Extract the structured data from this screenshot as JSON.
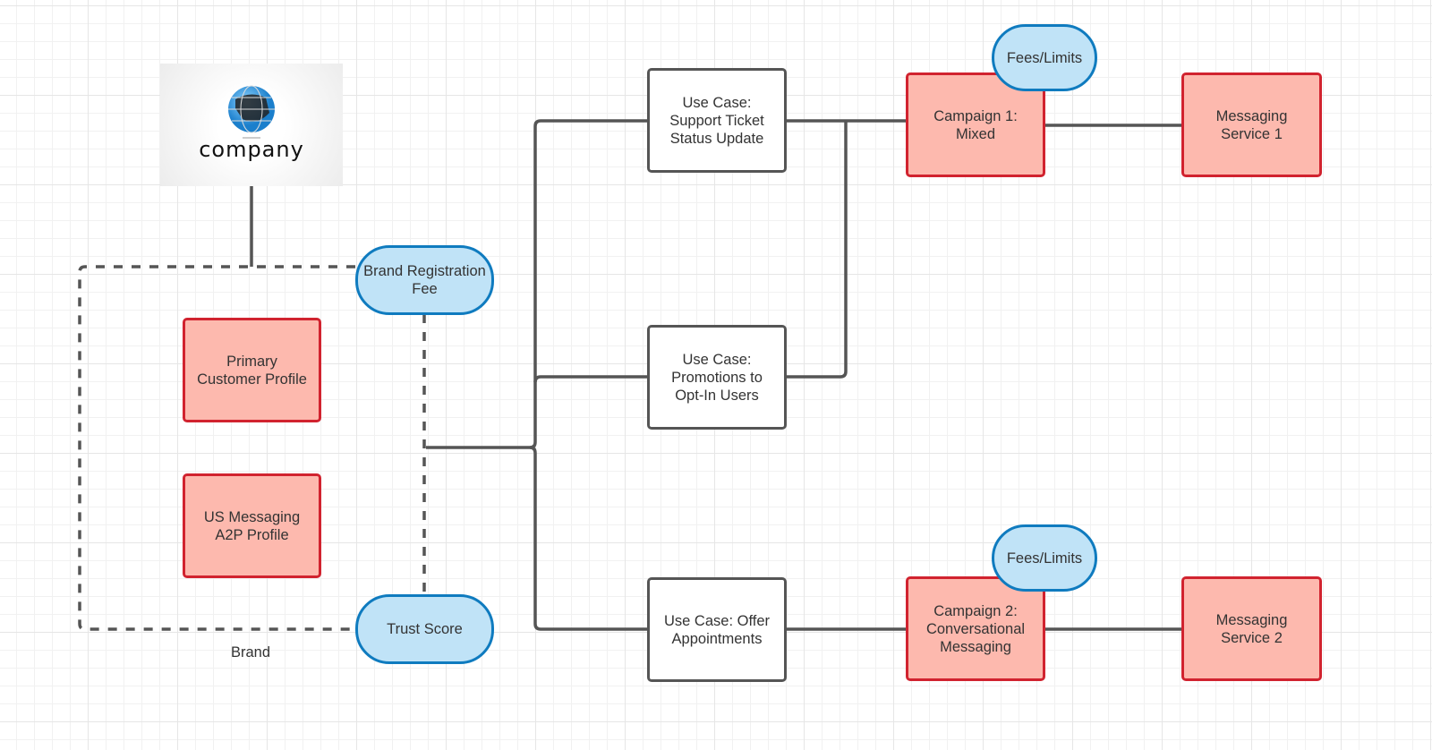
{
  "logo": {
    "text": "company",
    "icon": "globe-icon"
  },
  "group_label": "Brand",
  "nodes": {
    "brand_registration_fee": "Brand Registration\nFee",
    "trust_score": "Trust Score",
    "primary_customer_profile": "Primary\nCustomer Profile",
    "us_messaging_a2p_profile": "US Messaging\nA2P Profile",
    "use_case_support": "Use Case:\nSupport Ticket\nStatus Update",
    "use_case_promotions": "Use Case:\nPromotions to\nOpt-In Users",
    "use_case_appointments": "Use Case: Offer\nAppointments",
    "campaign_1": "Campaign 1:\nMixed",
    "campaign_2": "Campaign 2:\nConversational\nMessaging",
    "fees_limits_1": "Fees/Limits",
    "fees_limits_2": "Fees/Limits",
    "messaging_service_1": "Messaging\nService 1",
    "messaging_service_2": "Messaging\nService 2"
  },
  "colors": {
    "line": "#555555",
    "red_fill": "#fdb9ae",
    "red_border": "#d1232f",
    "blue_fill": "#c0e3f7",
    "blue_border": "#0f7bbf"
  }
}
